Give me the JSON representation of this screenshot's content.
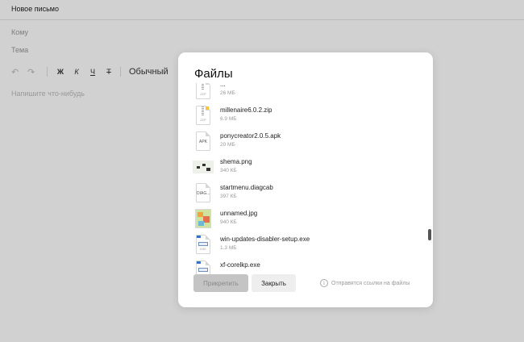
{
  "compose": {
    "title": "Новое письмо",
    "to_label": "Кому",
    "subject_label": "Тема",
    "toolbar": {
      "undo_icon": "↶",
      "redo_icon": "↷",
      "bold": "Ж",
      "italic": "К",
      "underline": "Ч",
      "strike": "Т",
      "text_style": "Обычный",
      "caret": "▾"
    },
    "body_placeholder": "Напишите что-нибудь"
  },
  "modal": {
    "title": "Файлы",
    "files": [
      {
        "name": "...",
        "size": "26 МБ",
        "thumb": "zip-icon"
      },
      {
        "name": "millenaire6.0.2.zip",
        "size": "6.9 МБ",
        "thumb": "zip-icon"
      },
      {
        "name": "ponycreator2.0.5.apk",
        "size": "20 МБ",
        "thumb": "apk-icon"
      },
      {
        "name": "shema.png",
        "size": "340 КБ",
        "thumb": "image-preview"
      },
      {
        "name": "startmenu.diagcab",
        "size": "397 КБ",
        "thumb": "diagcab-icon"
      },
      {
        "name": "unnamed.jpg",
        "size": "940 КБ",
        "thumb": "image-preview"
      },
      {
        "name": "win-updates-disabler-setup.exe",
        "size": "1.3 МБ",
        "thumb": "exe-icon"
      },
      {
        "name": "xf-corelkp.exe",
        "size": "",
        "thumb": "exe-icon"
      }
    ],
    "thumb_labels": {
      "zip": "ZIP",
      "apk": "APK",
      "diag": "DIAG...",
      "exe": "EXE"
    },
    "attach_button": "Прикрепить",
    "close_button": "Закрыть",
    "hint": "Отправятся ссылки на файлы",
    "info_icon": "i"
  }
}
